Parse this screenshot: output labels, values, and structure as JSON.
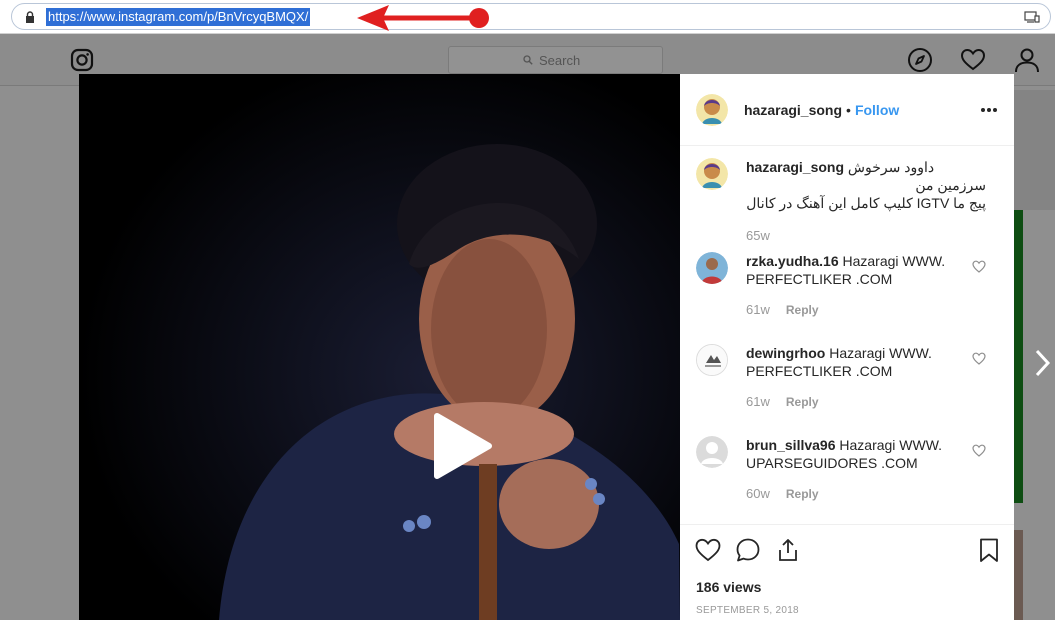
{
  "browser": {
    "url": "https://www.instagram.com/p/BnVrcyqBMQX/"
  },
  "ig_header": {
    "search_placeholder": "Search"
  },
  "post": {
    "username": "hazaragi_song",
    "separator": "•",
    "follow_label": "Follow",
    "caption": {
      "username": "hazaragi_song",
      "line1": "داوود سرخوش",
      "line2": "سرزمین من",
      "line3": "پیج ما IGTV کلیپ کامل این آهنگ در کانال",
      "age": "65w"
    },
    "comments": [
      {
        "username": "rzka.yudha.16",
        "text": "Hazaragi WWW. PERFECTLIKER .COM",
        "age": "61w",
        "reply": "Reply"
      },
      {
        "username": "dewingrhoo",
        "text": "Hazaragi WWW. PERFECTLIKER .COM",
        "age": "61w",
        "reply": "Reply"
      },
      {
        "username": "brun_sillva96",
        "text": "Hazaragi WWW. UPARSEGUIDORES .COM",
        "age": "60w",
        "reply": "Reply"
      }
    ],
    "views": "186 views",
    "date": "SEPTEMBER 5, 2018"
  },
  "colors": {
    "follow": "#3897f0",
    "url_highlight": "#2f6fd6",
    "arrow": "#e02020"
  }
}
